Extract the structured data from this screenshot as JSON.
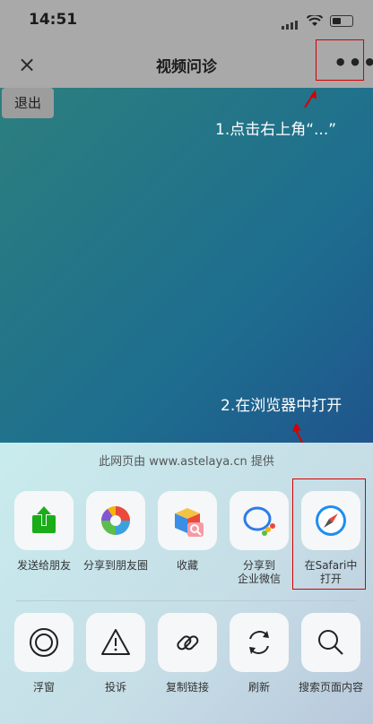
{
  "status": {
    "time": "14:51"
  },
  "nav": {
    "title": "视频问诊",
    "close_glyph": "×",
    "more_glyph": "•••"
  },
  "page": {
    "exit_label": "退出",
    "annotation1": "1.点击右上角“...”",
    "annotation2": "2.在浏览器中打开"
  },
  "sheet": {
    "provider": "此网页由 www.astelaya.cn 提供",
    "row1": [
      {
        "label": "发送给朋友",
        "icon": "send-to-friend-icon"
      },
      {
        "label": "分享到朋友圈",
        "icon": "moments-icon"
      },
      {
        "label": "收藏",
        "icon": "favorites-icon"
      },
      {
        "label": "分享到\n企业微信",
        "icon": "wecom-icon"
      },
      {
        "label": "在Safari中\n打开",
        "icon": "safari-icon"
      }
    ],
    "row2": [
      {
        "label": "浮窗",
        "icon": "floating-window-icon"
      },
      {
        "label": "投诉",
        "icon": "warning-icon"
      },
      {
        "label": "复制链接",
        "icon": "link-icon"
      },
      {
        "label": "刷新",
        "icon": "refresh-icon"
      },
      {
        "label": "搜索页面内容",
        "icon": "search-icon"
      }
    ]
  },
  "colors": {
    "highlight": "#d40000",
    "page_gradient_start": "#2c7f7e",
    "page_gradient_end": "#203b8a"
  }
}
